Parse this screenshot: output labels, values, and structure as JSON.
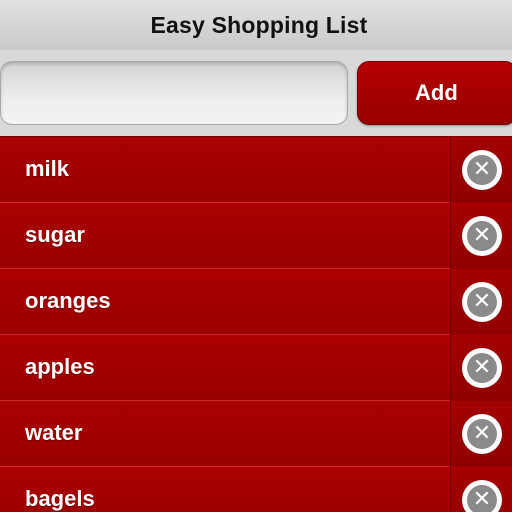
{
  "app": {
    "title": "Easy Shopping List"
  },
  "input": {
    "value": "",
    "placeholder": ""
  },
  "add_button": {
    "label": "Add"
  },
  "items": [
    {
      "label": "milk"
    },
    {
      "label": "sugar"
    },
    {
      "label": "oranges"
    },
    {
      "label": "apples"
    },
    {
      "label": "water"
    },
    {
      "label": "bagels"
    }
  ],
  "icons": {
    "delete": "close-circle-icon",
    "delete_glyph": "✕"
  },
  "colors": {
    "accent": "#a00000",
    "title_bg": "#d6d6d6"
  }
}
